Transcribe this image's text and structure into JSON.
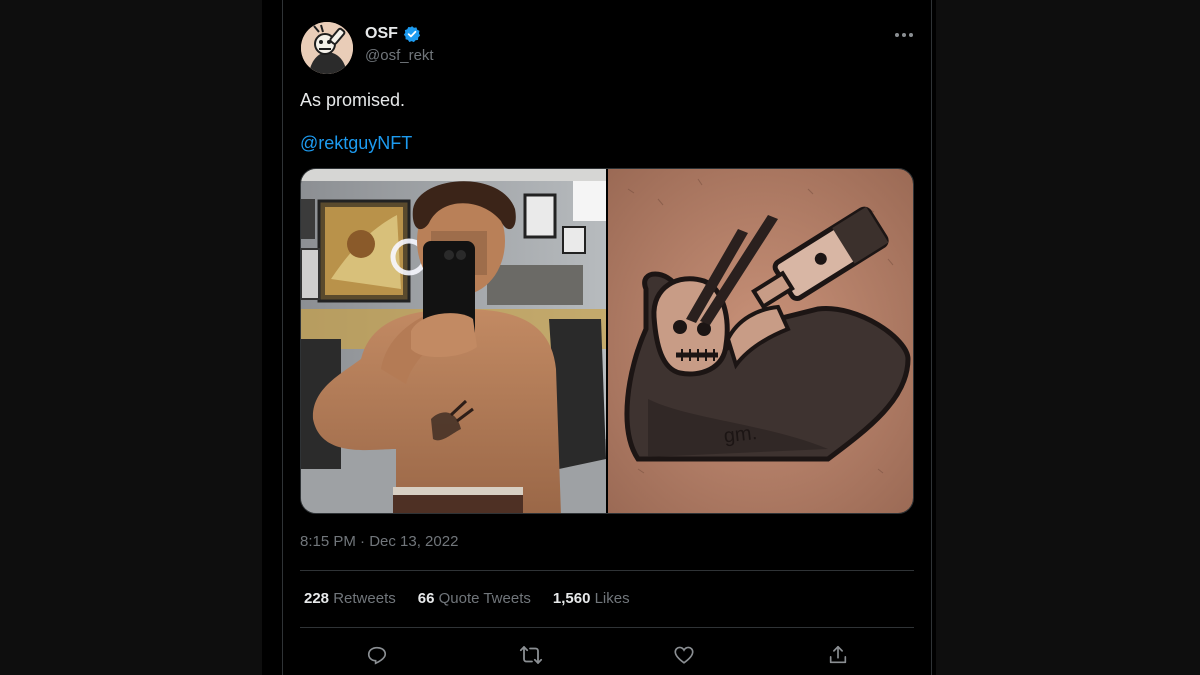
{
  "tweet": {
    "author": {
      "display_name": "OSF",
      "handle": "@osf_rekt",
      "verified": true
    },
    "text": "As promised.",
    "mention": "@rektguyNFT",
    "timestamp": "8:15 PM · Dec 13, 2022",
    "stats": {
      "retweets_count": "228",
      "retweets_label": "Retweets",
      "quotes_count": "66",
      "quotes_label": "Quote Tweets",
      "likes_count": "1,560",
      "likes_label": "Likes"
    },
    "actions": [
      "reply-icon",
      "retweet-icon",
      "like-icon",
      "share-icon"
    ]
  },
  "colors": {
    "background": "#000000",
    "text": "#e7e9ea",
    "secondary": "#71767b",
    "accent": "#1d9bf0",
    "divider": "#2f3336"
  }
}
